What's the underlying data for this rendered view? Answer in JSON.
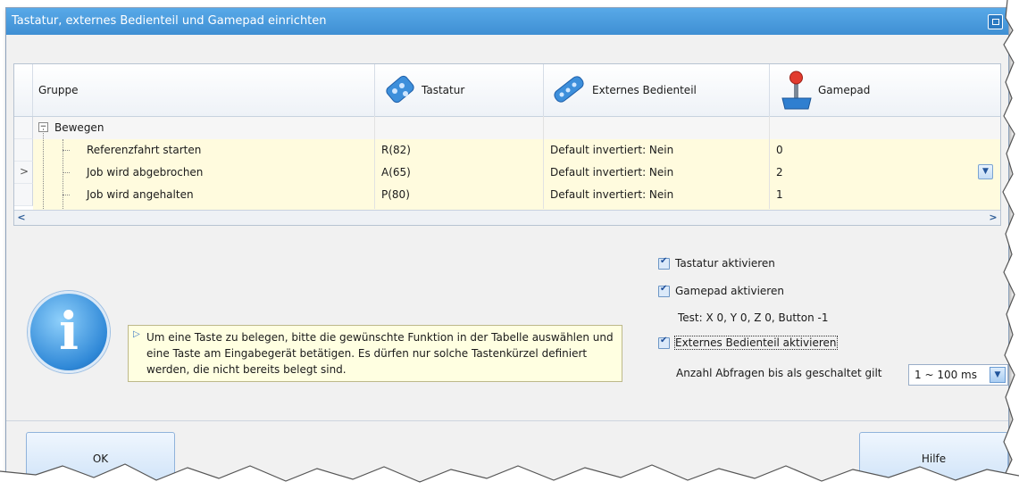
{
  "window": {
    "title": "Tastatur, externes Bedienteil und Gamepad einrichten"
  },
  "grid": {
    "columns": [
      {
        "label": "Gruppe",
        "icon": ""
      },
      {
        "label": "Tastatur",
        "icon": "keyboard-icon"
      },
      {
        "label": "Externes Bedienteil",
        "icon": "remote-control-icon"
      },
      {
        "label": "Gamepad",
        "icon": "joystick-icon"
      }
    ],
    "group_label": "Bewegen",
    "rows": [
      {
        "name": "Referenzfahrt starten",
        "tastatur": "R(82)",
        "bedienteil": "Default invertiert: Nein",
        "gamepad": "0"
      },
      {
        "name": "Job wird abgebrochen",
        "tastatur": "A(65)",
        "bedienteil": "Default invertiert: Nein",
        "gamepad": "2"
      },
      {
        "name": "Job wird angehalten",
        "tastatur": "P(80)",
        "bedienteil": "Default invertiert: Nein",
        "gamepad": "1"
      }
    ],
    "row_indicator": ">"
  },
  "hint": {
    "text": "Um eine Taste zu belegen, bitte die gewünschte Funktion in der Tabelle auswählen und eine Taste am Eingabegerät betätigen. Es dürfen nur solche Tastenkürzel definiert werden, die nicht bereits belegt sind."
  },
  "options": {
    "tastatur_label": "Tastatur aktivieren",
    "gamepad_label": "Gamepad aktivieren",
    "test_text": "Test: X 0, Y 0, Z 0, Button -1",
    "extern_label": "Externes Bedienteil aktivieren",
    "abfragen_label": "Anzahl Abfragen bis als geschaltet gilt",
    "abfragen_value": "1 ~ 100 ms"
  },
  "buttons": {
    "ok": "OK",
    "hilfe": "Hilfe"
  }
}
